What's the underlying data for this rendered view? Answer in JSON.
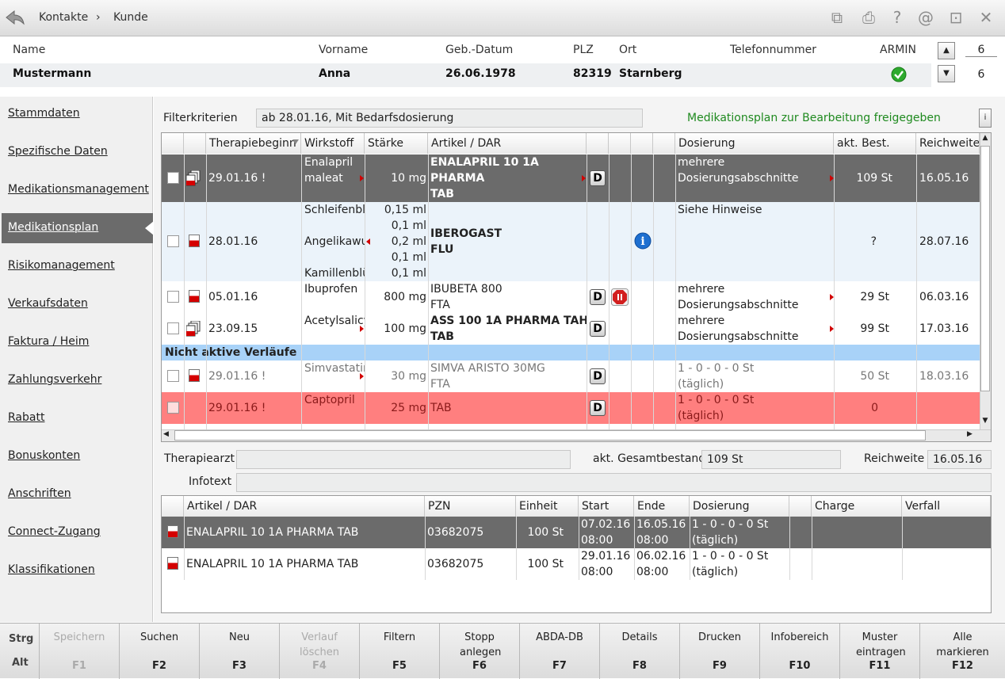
{
  "breadcrumb": {
    "first": "Kontakte",
    "sep": "›",
    "second": "Kunde"
  },
  "topicons": [
    "copy-icon",
    "print-icon",
    "help-icon",
    "at-icon",
    "window-icon",
    "close-icon"
  ],
  "customer": {
    "headers": {
      "name": "Name",
      "vorname": "Vorname",
      "geb": "Geb.-Datum",
      "plz": "PLZ",
      "ort": "Ort",
      "tel": "Telefonnummer",
      "armin": "ARMIN"
    },
    "values": {
      "name": "Mustermann",
      "vorname": "Anna",
      "geb": "26.06.1978",
      "plz": "82319",
      "ort": "Starnberg",
      "tel": ""
    },
    "counter_top": "6",
    "counter_bottom": "6"
  },
  "nav": [
    {
      "label": "Stammdaten"
    },
    {
      "label": "Spezifische Daten"
    },
    {
      "label": "Medikationsmanagement"
    },
    {
      "label": "Medikationsplan"
    },
    {
      "label": "Risikomanagement"
    },
    {
      "label": "Verkaufsdaten"
    },
    {
      "label": "Faktura / Heim"
    },
    {
      "label": "Zahlungsverkehr"
    },
    {
      "label": "Rabatt"
    },
    {
      "label": "Bonuskonten"
    },
    {
      "label": "Anschriften"
    },
    {
      "label": "Connect-Zugang"
    },
    {
      "label": "Klassifikationen"
    }
  ],
  "filter": {
    "label": "Filterkriterien",
    "value": "ab 28.01.16, Mit Bedarfsdosierung",
    "status": "Medikationsplan zur Bearbeitung freigegeben",
    "info_btn": "i"
  },
  "upper_columns": [
    "Therapiebeginn",
    "Wirkstoff",
    "Stärke",
    "Artikel / DAR",
    "Dosierung",
    "akt. Best.",
    "Reichweite"
  ],
  "rows": [
    {
      "date": "29.01.16 !",
      "wirk": [
        "Enalapril",
        "maleat"
      ],
      "staerke": [
        "10 mg"
      ],
      "artikel": [
        "ENALAPRIL 10 1A",
        "PHARMA",
        "TAB"
      ],
      "d": "D",
      "dos": [
        "mehrere",
        "Dosierungsabschnitte"
      ],
      "best": "109 St",
      "reich": "16.05.16"
    },
    {
      "date": "28.01.16",
      "wirk": [
        "Schleifenblü",
        "Angelikawu",
        "Kamillenblü"
      ],
      "staerke": [
        "0,15 ml",
        "0,1 ml",
        "0,2 ml",
        "0,1 ml",
        "0,1 ml"
      ],
      "artikel": [
        "IBEROGAST",
        "FLU"
      ],
      "d": "",
      "dos": [
        "Siehe Hinweise"
      ],
      "best": "?",
      "reich": "28.07.16"
    },
    {
      "date": "05.01.16",
      "wirk": [
        "Ibuprofen"
      ],
      "staerke": [
        "800 mg"
      ],
      "artikel": [
        "IBUBETA 800",
        "FTA"
      ],
      "d": "D",
      "dos": [
        "mehrere",
        "Dosierungsabschnitte"
      ],
      "best": "29 St",
      "reich": "06.03.16"
    },
    {
      "date": "23.09.15",
      "wirk": [
        "Acetylsalicy"
      ],
      "staerke": [
        "100 mg"
      ],
      "artikel": [
        "ASS 100 1A PHARMA TAH",
        "TAB"
      ],
      "d": "D",
      "dos": [
        "mehrere",
        "Dosierungsabschnitte"
      ],
      "best": "99 St",
      "reich": "17.03.16"
    },
    {
      "section": "Nicht aktive Verläufe"
    },
    {
      "date": "29.01.16 !",
      "wirk": [
        "Simvastatin"
      ],
      "staerke": [
        "30 mg"
      ],
      "artikel": [
        "SIMVA ARISTO 30MG",
        "FTA"
      ],
      "d": "D",
      "dos": [
        "1 - 0 - 0 - 0 St",
        "(täglich)"
      ],
      "best": "50 St",
      "reich": "18.03.16"
    },
    {
      "date": "29.01.16 !",
      "wirk": [
        "Captopril"
      ],
      "staerke": [
        "25 mg"
      ],
      "artikel": [
        "TAB"
      ],
      "d": "D",
      "dos": [
        "1 - 0 - 0 - 0 St",
        "(täglich)"
      ],
      "best": "0",
      "reich": ""
    }
  ],
  "details": {
    "arzt_label": "Therapiearzt",
    "arzt": "",
    "gesamt_label": "akt. Gesamtbestand",
    "gesamt": "109 St",
    "reich_label": "Reichweite",
    "reich": "16.05.16",
    "info_label": "Infotext",
    "info": ""
  },
  "lower_columns": [
    "Artikel / DAR",
    "PZN",
    "Einheit",
    "Start",
    "Ende",
    "Dosierung",
    "Charge",
    "Verfall"
  ],
  "lower_rows": [
    {
      "artikel": "ENALAPRIL 10 1A PHARMA TAB",
      "pzn": "03682075",
      "einheit": "100 St",
      "start": [
        "07.02.16",
        "08:00"
      ],
      "ende": [
        "16.05.16",
        "08:00"
      ],
      "dos": [
        "1 - 0 - 0 - 0 St",
        "(täglich)"
      ]
    },
    {
      "artikel": "ENALAPRIL 10 1A PHARMA TAB",
      "pzn": "03682075",
      "einheit": "100 St",
      "start": [
        "29.01.16",
        "08:00"
      ],
      "ende": [
        "06.02.16",
        "08:00"
      ],
      "dos": [
        "1 - 0 - 0 - 0 St",
        "(täglich)"
      ]
    }
  ],
  "fkeys": {
    "strg": "Strg",
    "alt": "Alt",
    "keys": [
      {
        "label": "Speichern",
        "key": "F1",
        "disabled": true
      },
      {
        "label": "Suchen",
        "key": "F2"
      },
      {
        "label": "Neu",
        "key": "F3"
      },
      {
        "label": "Verlauf löschen",
        "key": "F4",
        "disabled": true
      },
      {
        "label": "Filtern",
        "key": "F5"
      },
      {
        "label": "Stopp anlegen",
        "key": "F6"
      },
      {
        "label": "ABDA-DB",
        "key": "F7"
      },
      {
        "label": "Details",
        "key": "F8"
      },
      {
        "label": "Drucken",
        "key": "F9"
      },
      {
        "label": "Infobereich",
        "key": "F10"
      },
      {
        "label": "Muster eintragen",
        "key": "F11"
      },
      {
        "label": "Alle markieren",
        "key": "F12"
      }
    ]
  }
}
